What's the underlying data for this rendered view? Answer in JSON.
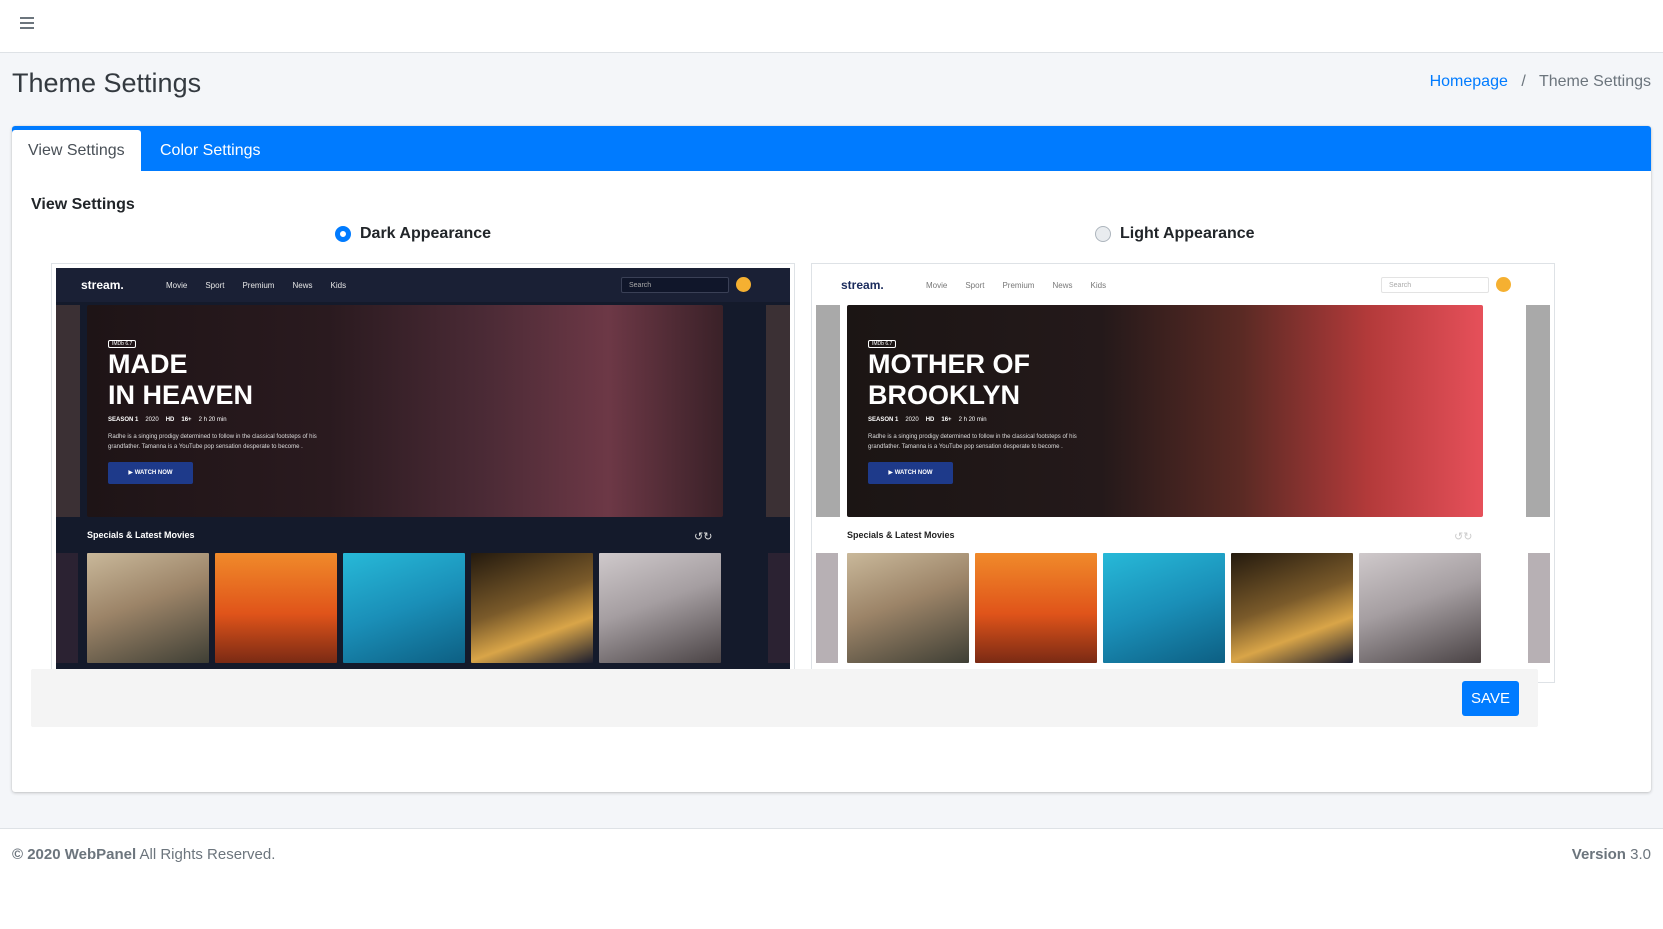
{
  "page": {
    "title": "Theme Settings"
  },
  "breadcrumb": {
    "home": "Homepage",
    "separator": "/",
    "current": "Theme Settings"
  },
  "tabs": [
    {
      "label": "View Settings",
      "active": true
    },
    {
      "label": "Color Settings",
      "active": false
    }
  ],
  "section": {
    "label": "View Settings"
  },
  "options": {
    "dark": {
      "label": "Dark Appearance",
      "selected": true
    },
    "light": {
      "label": "Light Appearance",
      "selected": false
    }
  },
  "preview": {
    "logo": "stream.",
    "menu": [
      "Movie",
      "Sport",
      "Premium",
      "News",
      "Kids"
    ],
    "search_placeholder": "Search",
    "badge": "IMDb 6.7",
    "meta": {
      "season": "SEASON 1",
      "year": "2020",
      "quality": "HD",
      "rating": "16+",
      "duration": "2 h 20 min"
    },
    "description": "Radhe is a singing prodigy determined to follow in the classical footsteps of his grandfather. Tamanna is a YouTube pop sensation desperate to become .",
    "watch_button": "WATCH NOW",
    "latest_title": "Specials & Latest Movies",
    "dark_hero_title": "MADE\nIN HEAVEN",
    "light_hero_title": "MOTHER OF\nBROOKLYN"
  },
  "actions": {
    "save_label": "SAVE"
  },
  "footer": {
    "copyright_bold": "© 2020 WebPanel",
    "copyright_rest": " All Rights Reserved.",
    "version_label": "Version",
    "version_value": " 3.0"
  },
  "colors": {
    "primary": "#007bff",
    "background": "#f4f6f9"
  }
}
